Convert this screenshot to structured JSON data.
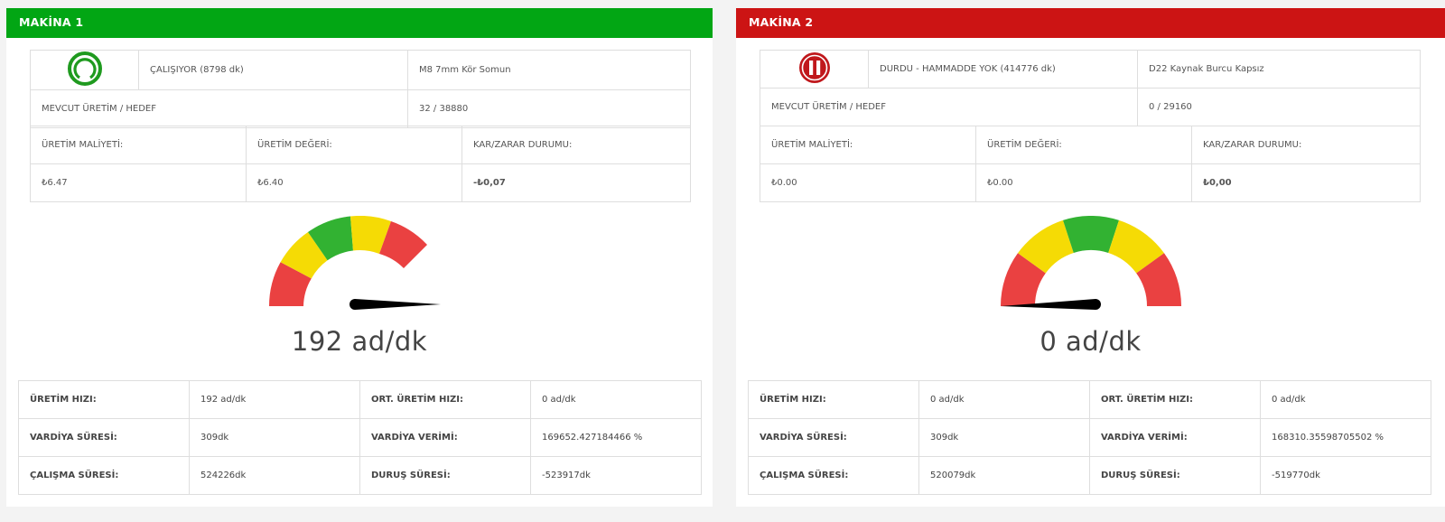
{
  "machines": [
    {
      "title": "MAKİNA 1",
      "header_color": "#02a614",
      "status_icon": "running-ring-icon",
      "status_text": "ÇALIŞIYOR (8798 dk)",
      "product": "M8 7mm Kör Somun",
      "production_label": "MEVCUT ÜRETİM / HEDEF",
      "production_value": "32 / 38880",
      "cost_label": "ÜRETİM MALİYETİ:",
      "value_label": "ÜRETİM DEĞERİ:",
      "profit_label": "KAR/ZARAR DURUMU:",
      "cost_value": "₺6.47",
      "value_value": "₺6.40",
      "profit_value": "-₺0,07",
      "gauge_value": 192,
      "speed_text": "192 ad/dk",
      "stats": [
        [
          "ÜRETİM HIZI:",
          "192 ad/dk",
          "ORT. ÜRETİM HIZI:",
          "0 ad/dk"
        ],
        [
          "VARDİYA SÜRESİ:",
          "309dk",
          "VARDİYA VERİMİ:",
          "169652.427184466 %"
        ],
        [
          "ÇALIŞMA SÜRESİ:",
          "524226dk",
          "DURUŞ SÜRESİ:",
          "-523917dk"
        ]
      ]
    },
    {
      "title": "MAKİNA 2",
      "header_color": "#cc1414",
      "status_icon": "pause-icon",
      "status_text": "DURDU - HAMMADDE YOK (414776 dk)",
      "product": "D22 Kaynak Burcu Kapsız",
      "production_label": "MEVCUT ÜRETİM / HEDEF",
      "production_value": "0 / 29160",
      "cost_label": "ÜRETİM MALİYETİ:",
      "value_label": "ÜRETİM DEĞERİ:",
      "profit_label": "KAR/ZARAR DURUMU:",
      "cost_value": "₺0.00",
      "value_value": "₺0.00",
      "profit_value": "₺0,00",
      "gauge_value": 0,
      "speed_text": "0 ad/dk",
      "stats": [
        [
          "ÜRETİM HIZI:",
          "0 ad/dk",
          "ORT. ÜRETİM HIZI:",
          "0 ad/dk"
        ],
        [
          "VARDİYA SÜRESİ:",
          "309dk",
          "VARDİYA VERİMİ:",
          "168310.35598705502 %"
        ],
        [
          "ÇALIŞMA SÜRESİ:",
          "520079dk",
          "DURUŞ SÜRESİ:",
          "-519770dk"
        ]
      ]
    }
  ],
  "gauge_colors": {
    "red": "#ea4141",
    "yellow": "#f5db05",
    "green": "#32b232",
    "needle": "#000000"
  }
}
